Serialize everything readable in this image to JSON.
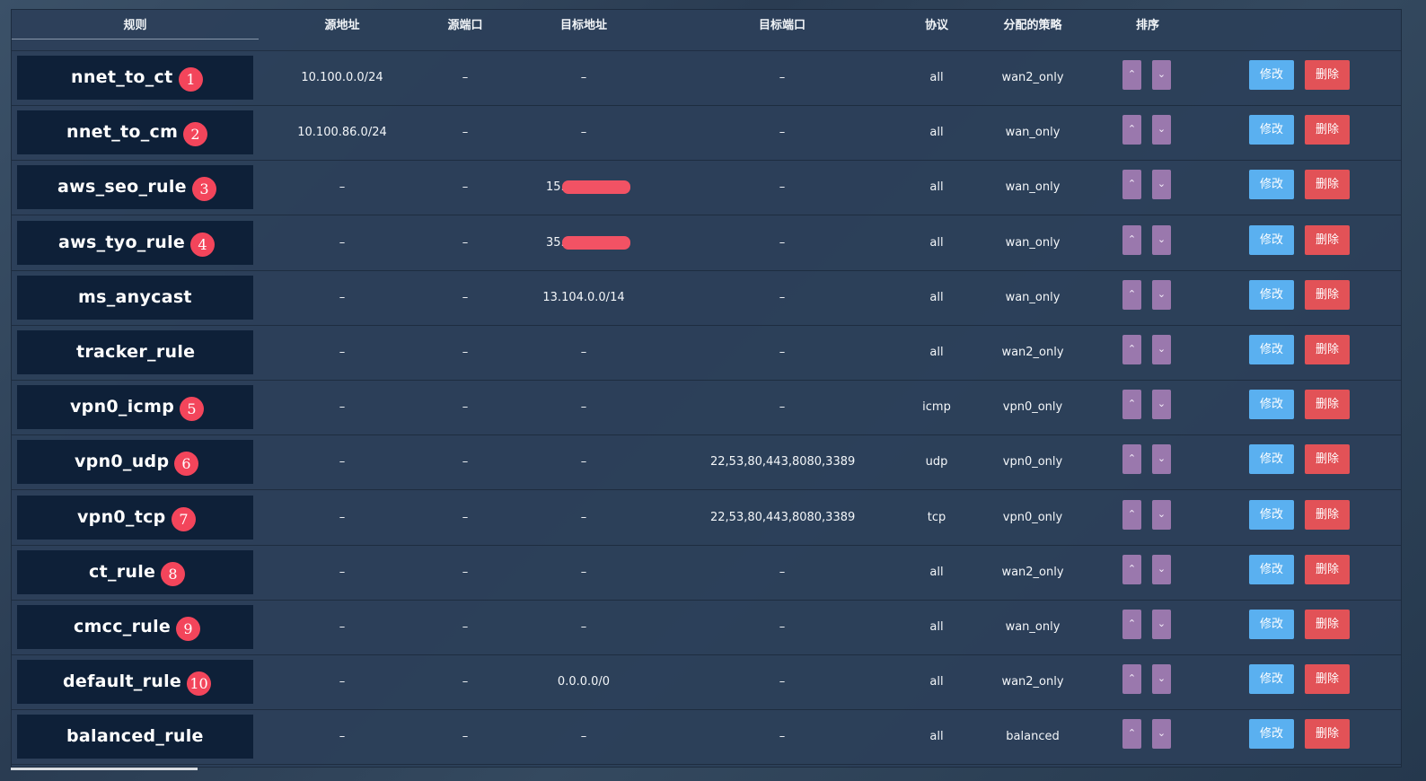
{
  "headers": {
    "rule": "规则",
    "src_addr": "源地址",
    "src_port": "源端口",
    "dst_addr": "目标地址",
    "dst_port": "目标端口",
    "protocol": "协议",
    "policy": "分配的策略",
    "sort": "排序"
  },
  "buttons": {
    "edit": "修改",
    "delete": "删除",
    "up": "⌃",
    "down": "⌄"
  },
  "rows": [
    {
      "name": "nnet_to_ct",
      "badge": "1",
      "src_addr": "10.100.0.0/24",
      "src_port": "–",
      "dst_addr": "–",
      "dst_redacted": false,
      "dst_port": "–",
      "protocol": "all",
      "policy": "wan2_only"
    },
    {
      "name": "nnet_to_cm",
      "badge": "2",
      "src_addr": "10.100.86.0/24",
      "src_port": "–",
      "dst_addr": "–",
      "dst_redacted": false,
      "dst_port": "–",
      "protocol": "all",
      "policy": "wan_only"
    },
    {
      "name": "aws_seo_rule",
      "badge": "3",
      "src_addr": "–",
      "src_port": "–",
      "dst_addr": "15.",
      "dst_redacted": true,
      "dst_port": "–",
      "protocol": "all",
      "policy": "wan_only"
    },
    {
      "name": "aws_tyo_rule",
      "badge": "4",
      "src_addr": "–",
      "src_port": "–",
      "dst_addr": "35.",
      "dst_redacted": true,
      "dst_port": "–",
      "protocol": "all",
      "policy": "wan_only"
    },
    {
      "name": "ms_anycast",
      "badge": "",
      "src_addr": "–",
      "src_port": "–",
      "dst_addr": "13.104.0.0/14",
      "dst_redacted": false,
      "dst_port": "–",
      "protocol": "all",
      "policy": "wan_only"
    },
    {
      "name": "tracker_rule",
      "badge": "",
      "src_addr": "–",
      "src_port": "–",
      "dst_addr": "–",
      "dst_redacted": false,
      "dst_port": "–",
      "protocol": "all",
      "policy": "wan2_only"
    },
    {
      "name": "vpn0_icmp",
      "badge": "5",
      "src_addr": "–",
      "src_port": "–",
      "dst_addr": "–",
      "dst_redacted": false,
      "dst_port": "–",
      "protocol": "icmp",
      "policy": "vpn0_only"
    },
    {
      "name": "vpn0_udp",
      "badge": "6",
      "src_addr": "–",
      "src_port": "–",
      "dst_addr": "–",
      "dst_redacted": false,
      "dst_port": "22,53,80,443,8080,3389",
      "protocol": "udp",
      "policy": "vpn0_only"
    },
    {
      "name": "vpn0_tcp",
      "badge": "7",
      "src_addr": "–",
      "src_port": "–",
      "dst_addr": "–",
      "dst_redacted": false,
      "dst_port": "22,53,80,443,8080,3389",
      "protocol": "tcp",
      "policy": "vpn0_only"
    },
    {
      "name": "ct_rule",
      "badge": "8",
      "src_addr": "–",
      "src_port": "–",
      "dst_addr": "–",
      "dst_redacted": false,
      "dst_port": "–",
      "protocol": "all",
      "policy": "wan2_only"
    },
    {
      "name": "cmcc_rule",
      "badge": "9",
      "src_addr": "–",
      "src_port": "–",
      "dst_addr": "–",
      "dst_redacted": false,
      "dst_port": "–",
      "protocol": "all",
      "policy": "wan_only"
    },
    {
      "name": "default_rule",
      "badge": "10",
      "src_addr": "–",
      "src_port": "–",
      "dst_addr": "0.0.0.0/0",
      "dst_redacted": false,
      "dst_port": "–",
      "protocol": "all",
      "policy": "wan2_only"
    },
    {
      "name": "balanced_rule",
      "badge": "",
      "src_addr": "–",
      "src_port": "–",
      "dst_addr": "–",
      "dst_redacted": false,
      "dst_port": "–",
      "protocol": "all",
      "policy": "balanced"
    }
  ]
}
